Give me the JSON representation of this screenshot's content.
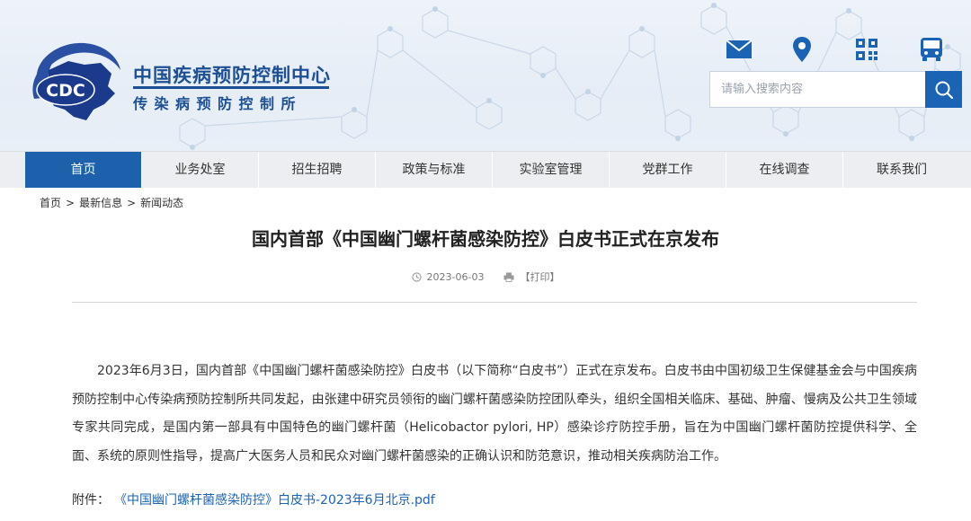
{
  "header": {
    "logo_text": "CDC",
    "org_name": "中国疾病预防控制中心",
    "org_sub": "传染病预防控制所",
    "search": {
      "placeholder": "请输入搜索内容"
    }
  },
  "nav": {
    "items": [
      {
        "label": "首页"
      },
      {
        "label": "业务处室"
      },
      {
        "label": "招生招聘"
      },
      {
        "label": "政策与标准"
      },
      {
        "label": "实验室管理"
      },
      {
        "label": "党群工作"
      },
      {
        "label": "在线调查"
      },
      {
        "label": "联系我们"
      }
    ]
  },
  "breadcrumb": [
    "首页",
    "最新信息",
    "新闻动态"
  ],
  "article": {
    "title": "国内首部《中国幽门螺杆菌感染防控》白皮书正式在京发布",
    "date": "2023-06-03",
    "print_label": "【打印】",
    "body": "2023年6月3日，国内首部《中国幽门螺杆菌感染防控》白皮书（以下简称“白皮书”）正式在京发布。白皮书由中国初级卫生保健基金会与中国疾病预防控制中心传染病预防控制所共同发起，由张建中研究员领衔的幽门螺杆菌感染防控团队牵头，组织全国相关临床、基础、肿瘤、慢病及公共卫生领域专家共同完成，是国内第一部具有中国特色的幽门螺杆菌（Helicobactor pylori, HP）感染诊疗防控手册，旨在为中国幽门螺杆菌防控提供科学、全面、系统的原则性指导，提高广大医务人员和民众对幽门螺杆菌感染的正确认识和防范意识，推动相关疾病防治工作。",
    "attachment_label": "附件：",
    "attachment_link": "《中国幽门螺杆菌感染防控》白皮书-2023年6月北京.pdf"
  },
  "colors": {
    "brand_blue": "#1c4f94",
    "nav_active": "#1d61ad",
    "link": "#1a63b5"
  }
}
